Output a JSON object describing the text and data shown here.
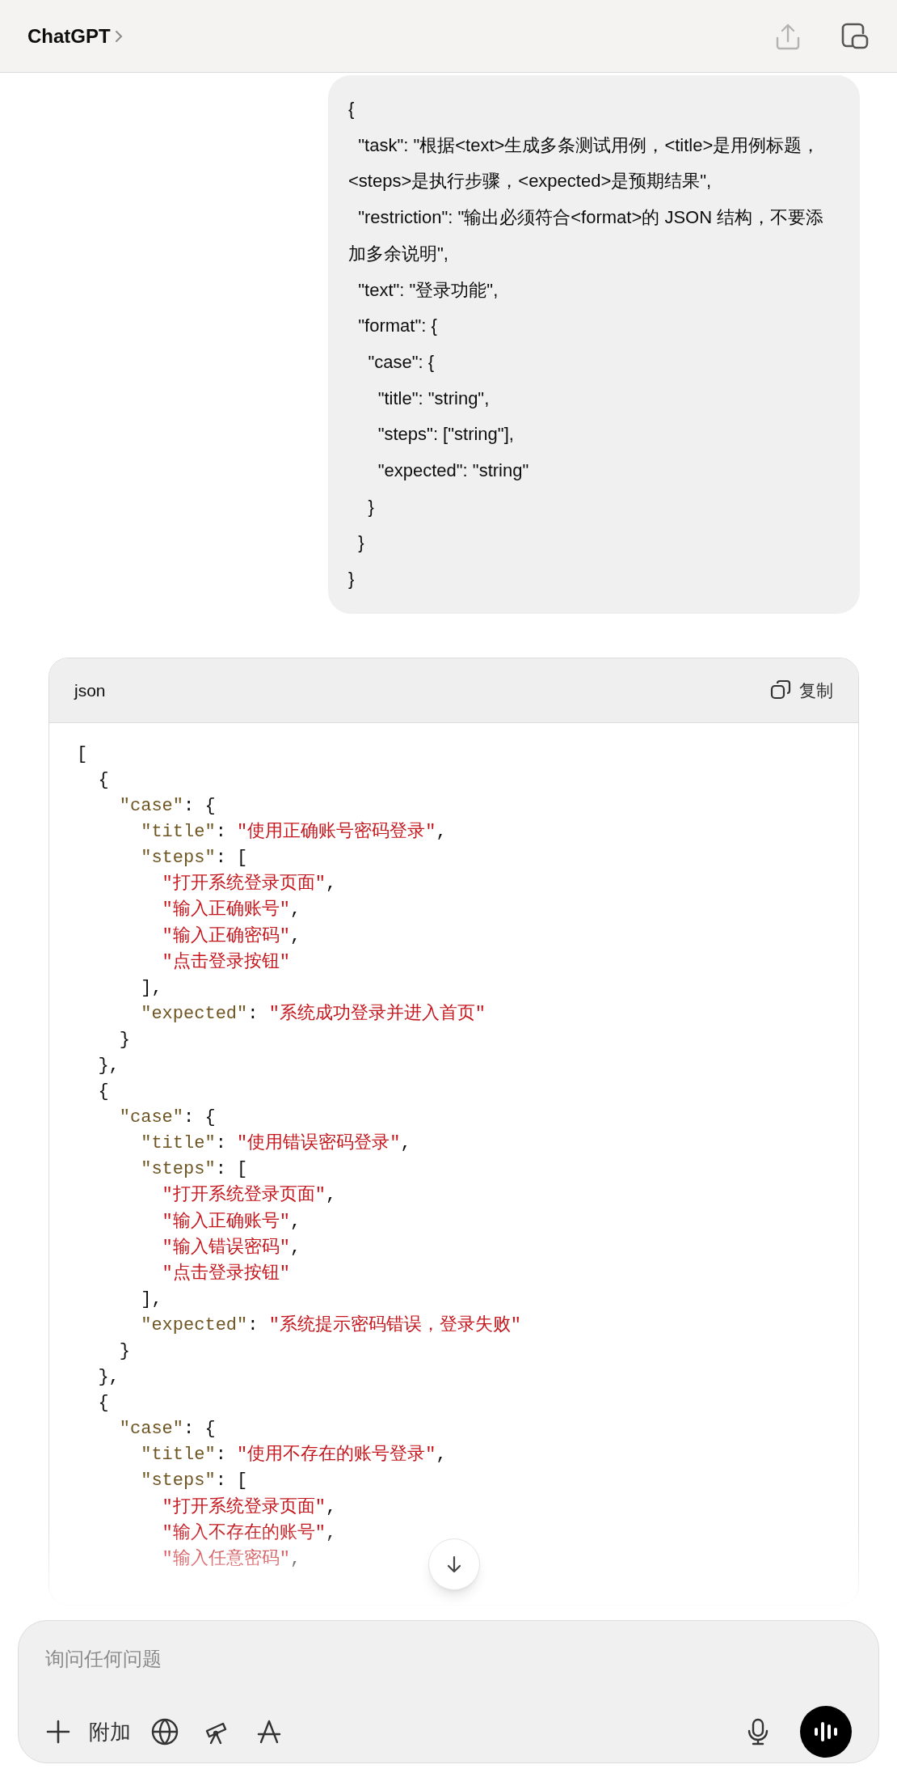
{
  "header": {
    "title": "ChatGPT"
  },
  "user_message": {
    "text": "{\n  \"task\": \"根据<text>生成多条测试用例，<title>是用例标题，<steps>是执行步骤，<expected>是预期结果\",\n  \"restriction\": \"输出必须符合<format>的 JSON 结构，不要添加多余说明\",\n  \"text\": \"登录功能\",\n  \"format\": {\n    \"case\": {\n      \"title\": \"string\",\n      \"steps\": [\"string\"],\n      \"expected\": \"string\"\n    }\n  }\n}"
  },
  "code_block": {
    "language": "json",
    "copy_label": "复制",
    "lines": [
      [
        {
          "kind": "plain",
          "text": "["
        }
      ],
      [
        {
          "kind": "plain",
          "text": "  {"
        }
      ],
      [
        {
          "kind": "key",
          "text": "    \"case\""
        },
        {
          "kind": "plain",
          "text": ": {"
        }
      ],
      [
        {
          "kind": "key",
          "text": "      \"title\""
        },
        {
          "kind": "plain",
          "text": ": "
        },
        {
          "kind": "string",
          "text": "\"使用正确账号密码登录\""
        },
        {
          "kind": "plain",
          "text": ","
        }
      ],
      [
        {
          "kind": "key",
          "text": "      \"steps\""
        },
        {
          "kind": "plain",
          "text": ": ["
        }
      ],
      [
        {
          "kind": "string",
          "text": "        \"打开系统登录页面\""
        },
        {
          "kind": "plain",
          "text": ","
        }
      ],
      [
        {
          "kind": "string",
          "text": "        \"输入正确账号\""
        },
        {
          "kind": "plain",
          "text": ","
        }
      ],
      [
        {
          "kind": "string",
          "text": "        \"输入正确密码\""
        },
        {
          "kind": "plain",
          "text": ","
        }
      ],
      [
        {
          "kind": "string",
          "text": "        \"点击登录按钮\""
        }
      ],
      [
        {
          "kind": "plain",
          "text": "      ],"
        }
      ],
      [
        {
          "kind": "key",
          "text": "      \"expected\""
        },
        {
          "kind": "plain",
          "text": ": "
        },
        {
          "kind": "string",
          "text": "\"系统成功登录并进入首页\""
        }
      ],
      [
        {
          "kind": "plain",
          "text": "    }"
        }
      ],
      [
        {
          "kind": "plain",
          "text": "  },"
        }
      ],
      [
        {
          "kind": "plain",
          "text": "  {"
        }
      ],
      [
        {
          "kind": "key",
          "text": "    \"case\""
        },
        {
          "kind": "plain",
          "text": ": {"
        }
      ],
      [
        {
          "kind": "key",
          "text": "      \"title\""
        },
        {
          "kind": "plain",
          "text": ": "
        },
        {
          "kind": "string",
          "text": "\"使用错误密码登录\""
        },
        {
          "kind": "plain",
          "text": ","
        }
      ],
      [
        {
          "kind": "key",
          "text": "      \"steps\""
        },
        {
          "kind": "plain",
          "text": ": ["
        }
      ],
      [
        {
          "kind": "string",
          "text": "        \"打开系统登录页面\""
        },
        {
          "kind": "plain",
          "text": ","
        }
      ],
      [
        {
          "kind": "string",
          "text": "        \"输入正确账号\""
        },
        {
          "kind": "plain",
          "text": ","
        }
      ],
      [
        {
          "kind": "string",
          "text": "        \"输入错误密码\""
        },
        {
          "kind": "plain",
          "text": ","
        }
      ],
      [
        {
          "kind": "string",
          "text": "        \"点击登录按钮\""
        }
      ],
      [
        {
          "kind": "plain",
          "text": "      ],"
        }
      ],
      [
        {
          "kind": "key",
          "text": "      \"expected\""
        },
        {
          "kind": "plain",
          "text": ": "
        },
        {
          "kind": "string",
          "text": "\"系统提示密码错误，登录失败\""
        }
      ],
      [
        {
          "kind": "plain",
          "text": "    }"
        }
      ],
      [
        {
          "kind": "plain",
          "text": "  },"
        }
      ],
      [
        {
          "kind": "plain",
          "text": "  {"
        }
      ],
      [
        {
          "kind": "key",
          "text": "    \"case\""
        },
        {
          "kind": "plain",
          "text": ": {"
        }
      ],
      [
        {
          "kind": "key",
          "text": "      \"title\""
        },
        {
          "kind": "plain",
          "text": ": "
        },
        {
          "kind": "string",
          "text": "\"使用不存在的账号登录\""
        },
        {
          "kind": "plain",
          "text": ","
        }
      ],
      [
        {
          "kind": "key",
          "text": "      \"steps\""
        },
        {
          "kind": "plain",
          "text": ": ["
        }
      ],
      [
        {
          "kind": "string",
          "text": "        \"打开系统登录页面\""
        },
        {
          "kind": "plain",
          "text": ","
        }
      ],
      [
        {
          "kind": "string",
          "text": "        \"输入不存在的账号\""
        },
        {
          "kind": "plain",
          "text": ","
        }
      ],
      [
        {
          "kind": "string",
          "text": "        \"输入任意密码\""
        },
        {
          "kind": "plain",
          "text": ","
        }
      ]
    ]
  },
  "composer": {
    "placeholder": "询问任何问题",
    "attach_label": "附加"
  }
}
